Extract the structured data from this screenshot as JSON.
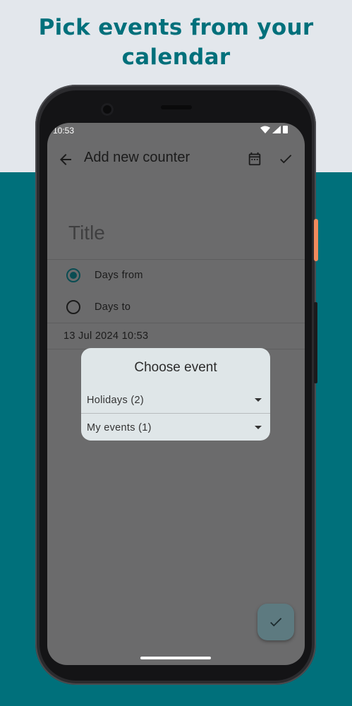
{
  "headline": {
    "line1": "Pick events from your",
    "line2": "calendar"
  },
  "status_bar": {
    "time": "10:53",
    "icons": [
      "wifi-icon",
      "signal-icon",
      "battery-icon"
    ]
  },
  "app_bar": {
    "back_icon": "arrow-left-icon",
    "title": "Add new counter",
    "calendar_icon": "calendar-icon",
    "confirm_icon": "check-icon"
  },
  "form": {
    "title_placeholder": "Title",
    "options": [
      {
        "label": "Days from",
        "selected": true
      },
      {
        "label": "Days to",
        "selected": false
      }
    ],
    "date_value": "13 Jul 2024 10:53"
  },
  "dialog": {
    "title": "Choose event",
    "dropdowns": [
      {
        "label": "Holidays (2)"
      },
      {
        "label": "My events (1)"
      }
    ]
  },
  "fab": {
    "icon": "check-icon"
  },
  "colors": {
    "brand_teal": "#00707b",
    "background_light": "#e3e7ec",
    "scrim_gray": "#6b6b6c",
    "dialog_surface": "#dfe6e8",
    "radio_selected": "#0a4c52",
    "phone_accent_orange": "#f08a5d"
  }
}
